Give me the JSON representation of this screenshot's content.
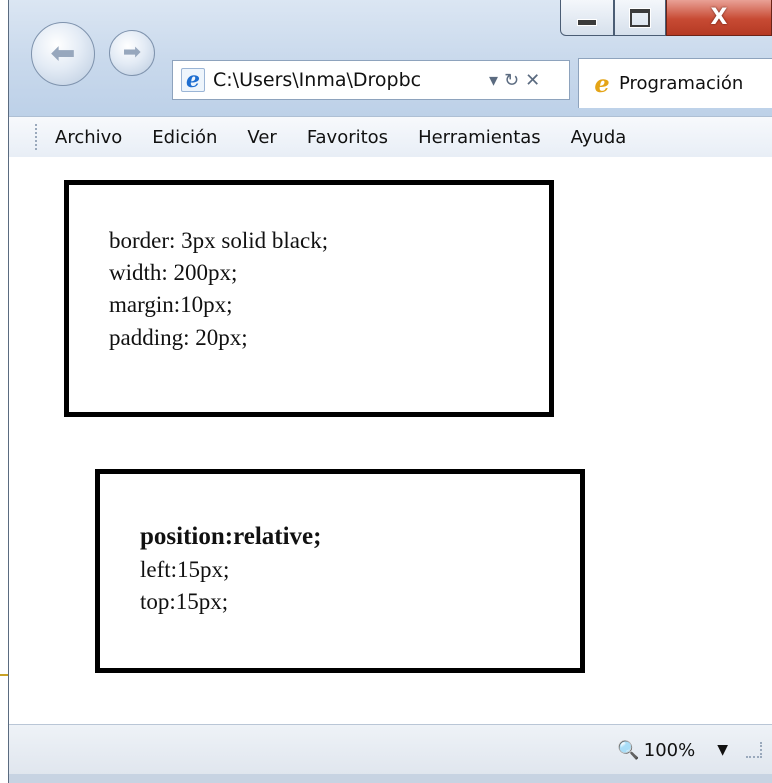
{
  "window": {
    "caption": {
      "minimize_icon": "minimize-icon",
      "maximize_icon": "maximize-icon",
      "close_glyph": "X"
    }
  },
  "toolbar": {
    "address": "C:\\Users\\Inma\\Dropbc",
    "dropdown_glyph": "▾",
    "refresh_glyph": "↻",
    "stop_glyph": "✕",
    "tab_title": "Programación"
  },
  "menu": {
    "items": [
      {
        "label": "Archivo"
      },
      {
        "label": "Edición"
      },
      {
        "label": "Ver"
      },
      {
        "label": "Favoritos"
      },
      {
        "label": "Herramientas"
      },
      {
        "label": "Ayuda"
      }
    ]
  },
  "content": {
    "box1": {
      "line1": "border: 3px solid black;",
      "line2": "width: 200px;",
      "line3": "margin:10px;",
      "line4": "padding: 20px;"
    },
    "box2": {
      "line1": "position:relative;",
      "line2": "left:15px;",
      "line3": "top:15px;"
    }
  },
  "status": {
    "zoom": "100%"
  }
}
